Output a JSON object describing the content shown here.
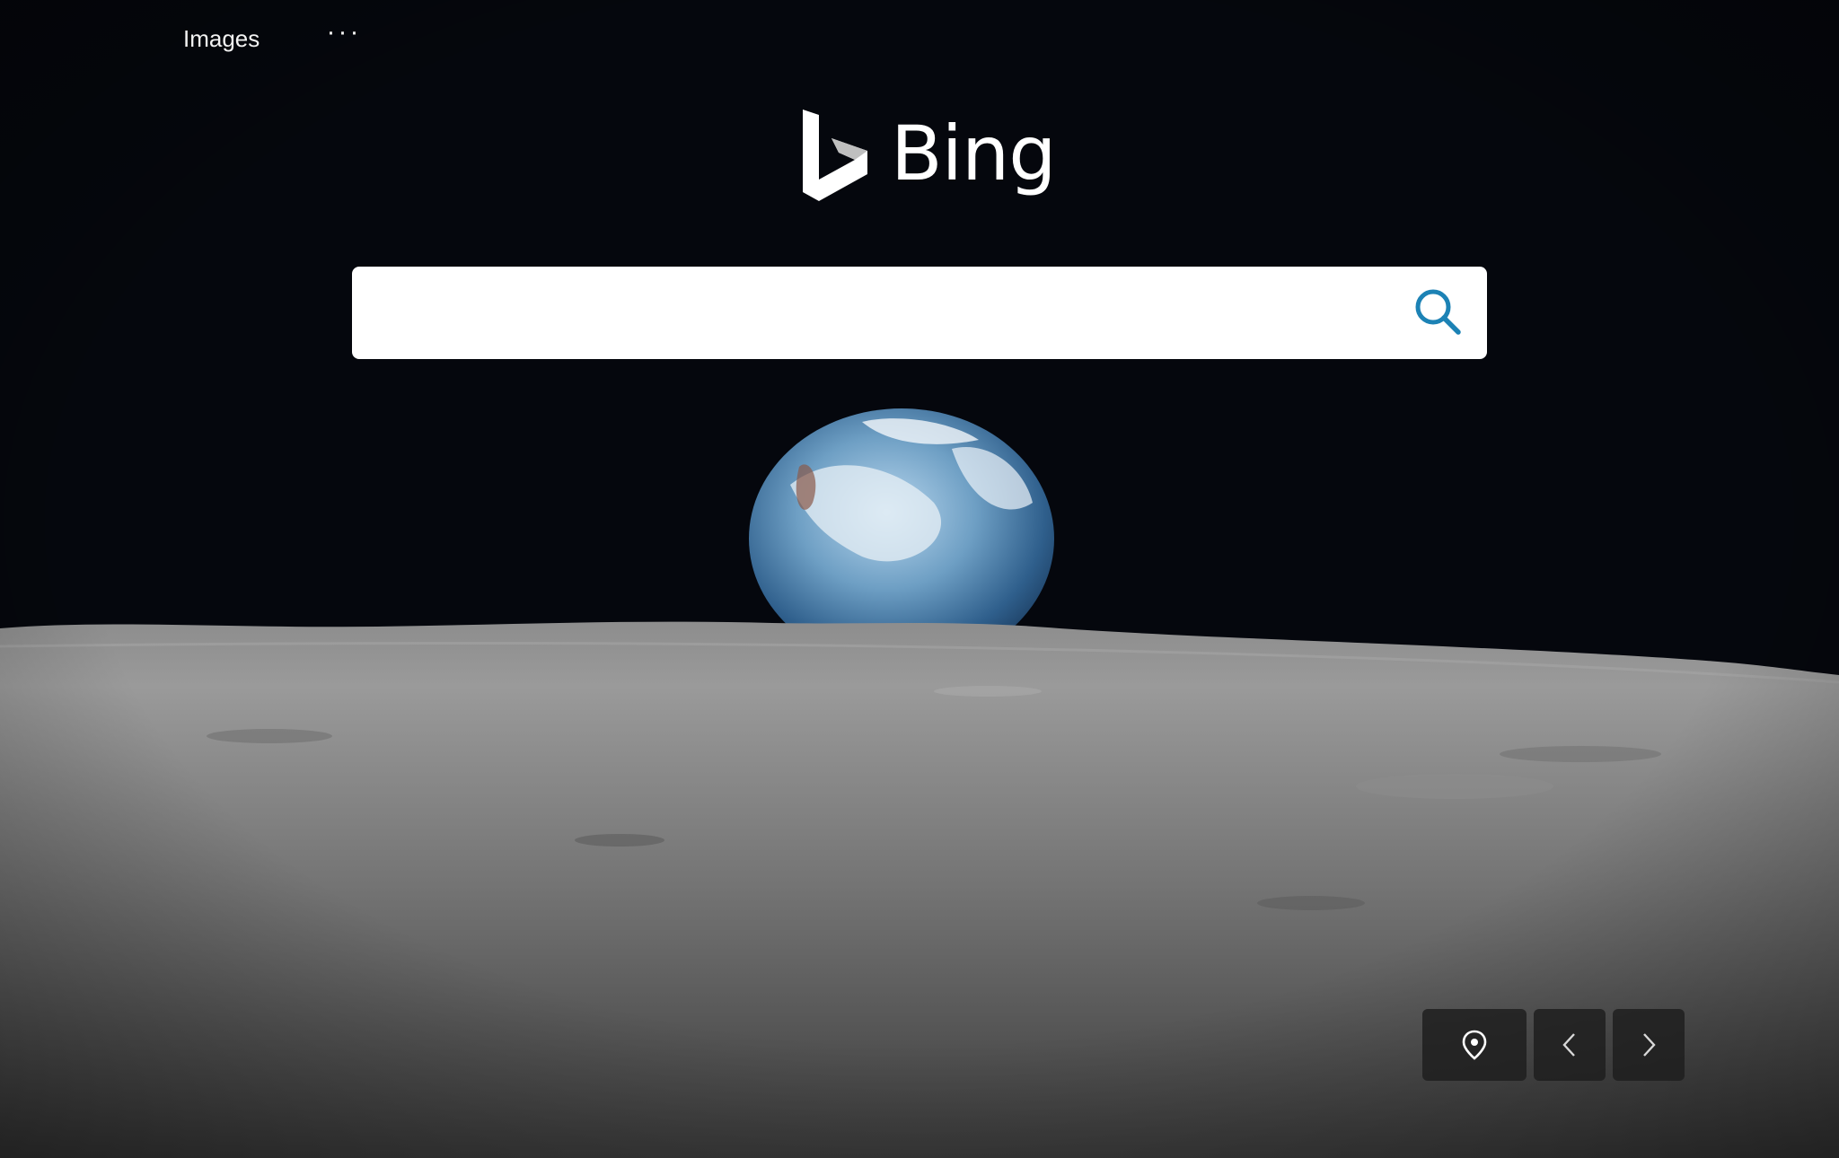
{
  "topnav": {
    "images_label": "Images",
    "more_label": "···"
  },
  "logo": {
    "text": "Bing"
  },
  "search": {
    "value": "",
    "placeholder": "",
    "icon": "search-icon"
  },
  "controls": {
    "location_icon": "location-pin-icon",
    "prev_icon": "chevron-left-icon",
    "next_icon": "chevron-right-icon"
  },
  "colors": {
    "sky": "#05070d",
    "search_icon": "#1c82b5",
    "control_bg": "#1e1e1e"
  }
}
